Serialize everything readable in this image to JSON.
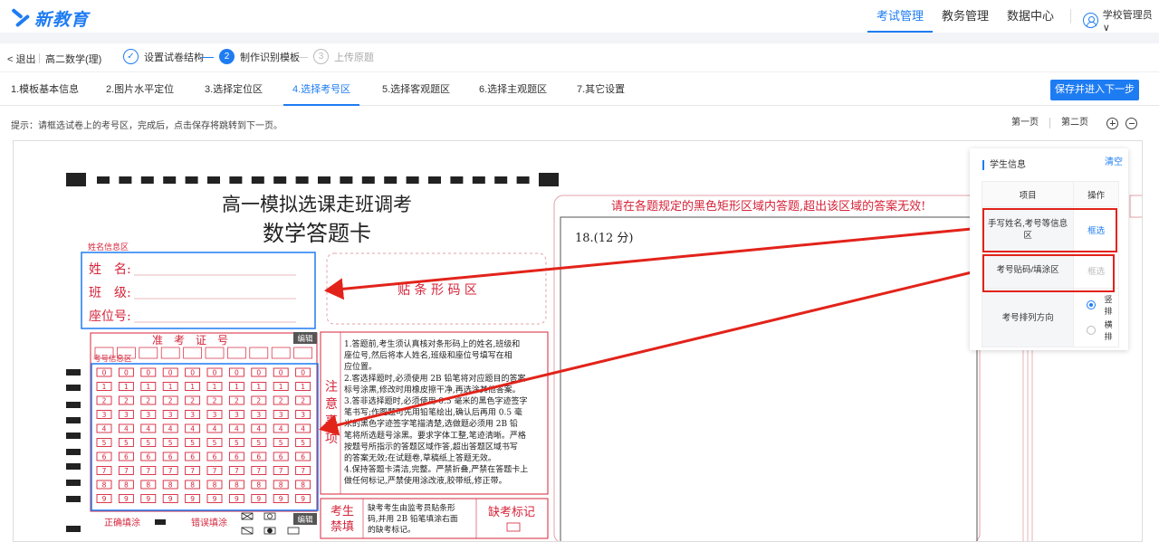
{
  "app": {
    "logo": "新教育"
  },
  "topnav": {
    "items": [
      "考试管理",
      "教务管理",
      "数据中心"
    ],
    "active": 0,
    "user": "学校管理员∨"
  },
  "stepbar": {
    "back": "< 退出",
    "course": "高二数学(理)",
    "steps": [
      {
        "num": "✓",
        "label": "设置试卷结构",
        "state": "done"
      },
      {
        "num": "2",
        "label": "制作识别模板",
        "state": "current"
      },
      {
        "num": "3",
        "label": "上传原题",
        "state": "todo"
      }
    ]
  },
  "tabs": {
    "items": [
      "1.模板基本信息",
      "2.图片水平定位",
      "3.选择定位区",
      "4.选择考号区",
      "5.选择客观题区",
      "6.选择主观题区",
      "7.其它设置"
    ],
    "active": 3,
    "save_label": "保存并进入下一步"
  },
  "hint": "提示：请框选试卷上的考号区，完成后，点击保存将跳转到下一页。",
  "pages": {
    "first": "第一页",
    "second": "第二页"
  },
  "sheet": {
    "title": "高一模拟选课走班调考",
    "subtitle": "数学答题卡",
    "name_area_label": "姓名信息区",
    "name_label": "姓　名:",
    "class_label": "班　级:",
    "seat_label": "座位号:",
    "barcode": "贴 条 形 码 区",
    "exam_no_header": "准　考　证　号",
    "exam_no_area_label": "考号信息区",
    "edit": "编辑",
    "notice_title": "注意事项",
    "notice_lines": [
      "1.答题前,考生须认真核对条形码上的姓名,班级和",
      "座位号,然后将本人姓名,班级和座位号填写在相",
      "应位置。",
      "2.客选择题时,必须使用 2B 铅笔将对应题目的答案",
      "标号涂黑,修改时用橡皮擦干净,再选涂其他答案。",
      "3.答非选择题时,必须使用 0.5 毫米的黑色字迹签字",
      "笔书写;作图题可先用铅笔绘出,确认后再用 0.5 毫",
      "米的黑色字迹签字笔描清楚,选做题必须用 2B 铅",
      "笔将所选题号涂黑。要求字体工整,笔迹清晰。严格",
      "按题号所指示的答题区域作答,超出答题区域书写",
      "的答案无效;在试题卷,草稿纸上答题无效。",
      "4.保持答题卡清洁,完整。严禁折叠,严禁在答题卡上",
      "做任何标记,严禁使用涂改液,胶带纸,修正带。"
    ],
    "absent_label": "考生禁填",
    "absent_text": [
      "缺考考生由监考员贴条形",
      "码,并用 2B 铅笔填涂右面",
      "的缺考标记。"
    ],
    "absent_mark": "缺考标记",
    "correct_fill": "正确填涂",
    "wrong_fill": "错误填涂",
    "digits": [
      "0",
      "1",
      "2",
      "3",
      "4",
      "5",
      "6",
      "7",
      "8",
      "9"
    ],
    "warning": "请在各题规定的黑色矩形区域内答题,超出该区域的答案无效!",
    "question": "18.(12 分)"
  },
  "panel": {
    "title": "学生信息",
    "clear": "清空",
    "col_item": "项目",
    "col_op": "操作",
    "rows": [
      {
        "item": "手写姓名,考号等信息区",
        "op": "框选"
      },
      {
        "item": "考号贴码/填涂区",
        "op": "框选"
      },
      {
        "item": "考号排列方向",
        "op": ""
      }
    ],
    "radio_vertical": "竖排",
    "radio_horizontal": "横排"
  },
  "colors": {
    "accent": "#1e7cf2",
    "sheet_red": "#d6243a",
    "arrow_red": "#e2231a",
    "select_blue": "#1e7cf2"
  }
}
